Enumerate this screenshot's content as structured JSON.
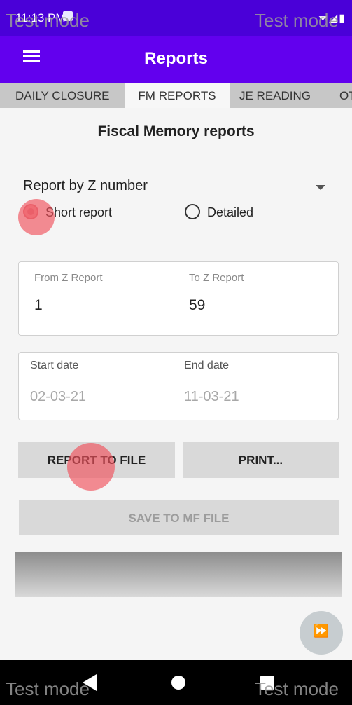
{
  "status_bar": {
    "time": "11:13 PM",
    "right_icons": "⏷◢▮"
  },
  "watermark": {
    "text": "Test mode"
  },
  "app_bar": {
    "title": "Reports"
  },
  "tabs": [
    {
      "label": "DAILY CLOSURE"
    },
    {
      "label": "FM REPORTS"
    },
    {
      "label": "JE READING"
    },
    {
      "label": "OT"
    }
  ],
  "main": {
    "heading": "Fiscal Memory reports",
    "report_type": "Report by Z number",
    "radio": {
      "short": "Short report",
      "detailed": "Detailed",
      "selected": "short"
    },
    "z_range": {
      "from_label": "From Z Report",
      "from_value": "1",
      "to_label": "To Z Report",
      "to_value": "59"
    },
    "date_range": {
      "start_label": "Start date",
      "start_value": "02-03-21",
      "end_label": "End date",
      "end_value": "11-03-21"
    },
    "buttons": {
      "report_to_file": "REPORT TO FILE",
      "print": "PRINT...",
      "save_mf": "SAVE TO MF FILE"
    }
  },
  "fab": {
    "glyph": "⏩"
  },
  "colors": {
    "status_bar": "#4a00d8",
    "app_bar": "#6200ee",
    "tab_bar": "#c7c7c7",
    "touch_indicator": "#f0505a"
  }
}
